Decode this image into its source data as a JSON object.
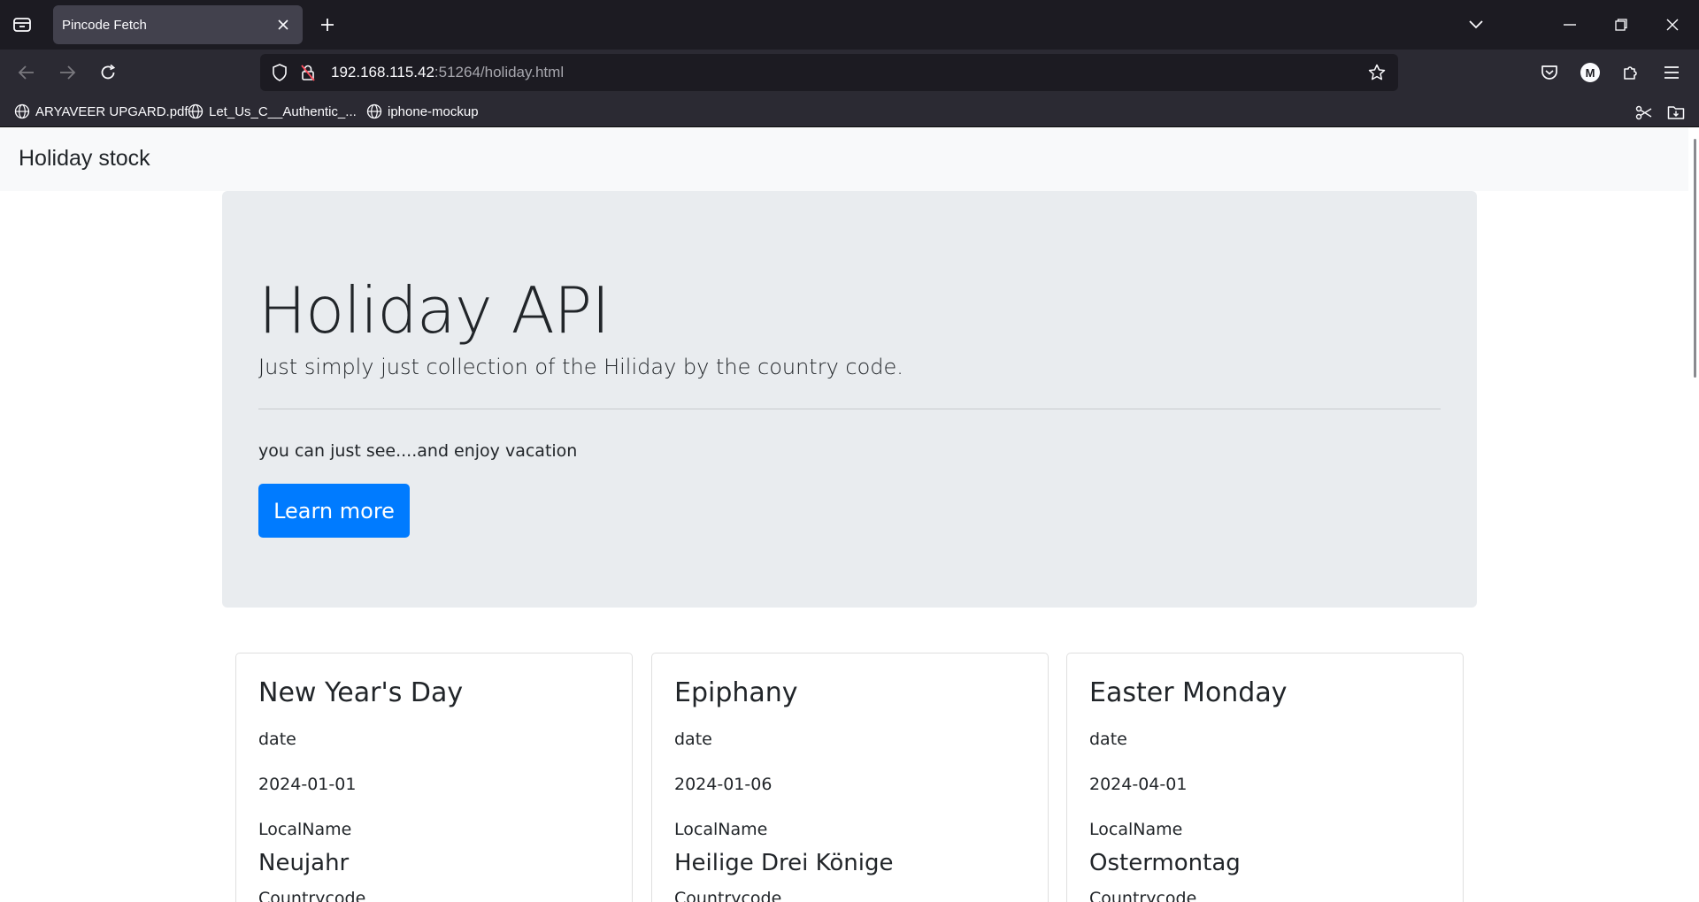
{
  "browser": {
    "tab": {
      "title": "Pincode Fetch"
    },
    "url": {
      "host": "192.168.115.42",
      "rest": ":51264/holiday.html"
    },
    "bookmarks": [
      {
        "label": "ARYAVEER UPGARD.pdf"
      },
      {
        "label": "Let_Us_C__Authentic_..."
      },
      {
        "label": "iphone-mockup"
      }
    ],
    "profile_initial": "M",
    "colors": {
      "titlebar": "#1c1b22",
      "toolbar": "#2b2a33",
      "tab_active": "#42414d"
    }
  },
  "page": {
    "brand": "Holiday stock",
    "hero": {
      "title": "Holiday API",
      "lead": "Just simply just collection of the Hiliday by the country code.",
      "note": "you can just see....and enjoy vacation",
      "button": "Learn more"
    },
    "cards": [
      {
        "name": "New Year's Day",
        "date_label": "date",
        "date": "2024-01-01",
        "local_label": "LocalName",
        "local_name": "Neujahr",
        "next_label": "Countrycode"
      },
      {
        "name": "Epiphany",
        "date_label": "date",
        "date": "2024-01-06",
        "local_label": "LocalName",
        "local_name": "Heilige Drei Könige",
        "next_label": "Countrycode"
      },
      {
        "name": "Easter Monday",
        "date_label": "date",
        "date": "2024-04-01",
        "local_label": "LocalName",
        "local_name": "Ostermontag",
        "next_label": "Countrycode"
      }
    ],
    "colors": {
      "primary": "#007bff",
      "jumbotron": "#e9ecef",
      "navbar": "#f8f9fa"
    }
  }
}
